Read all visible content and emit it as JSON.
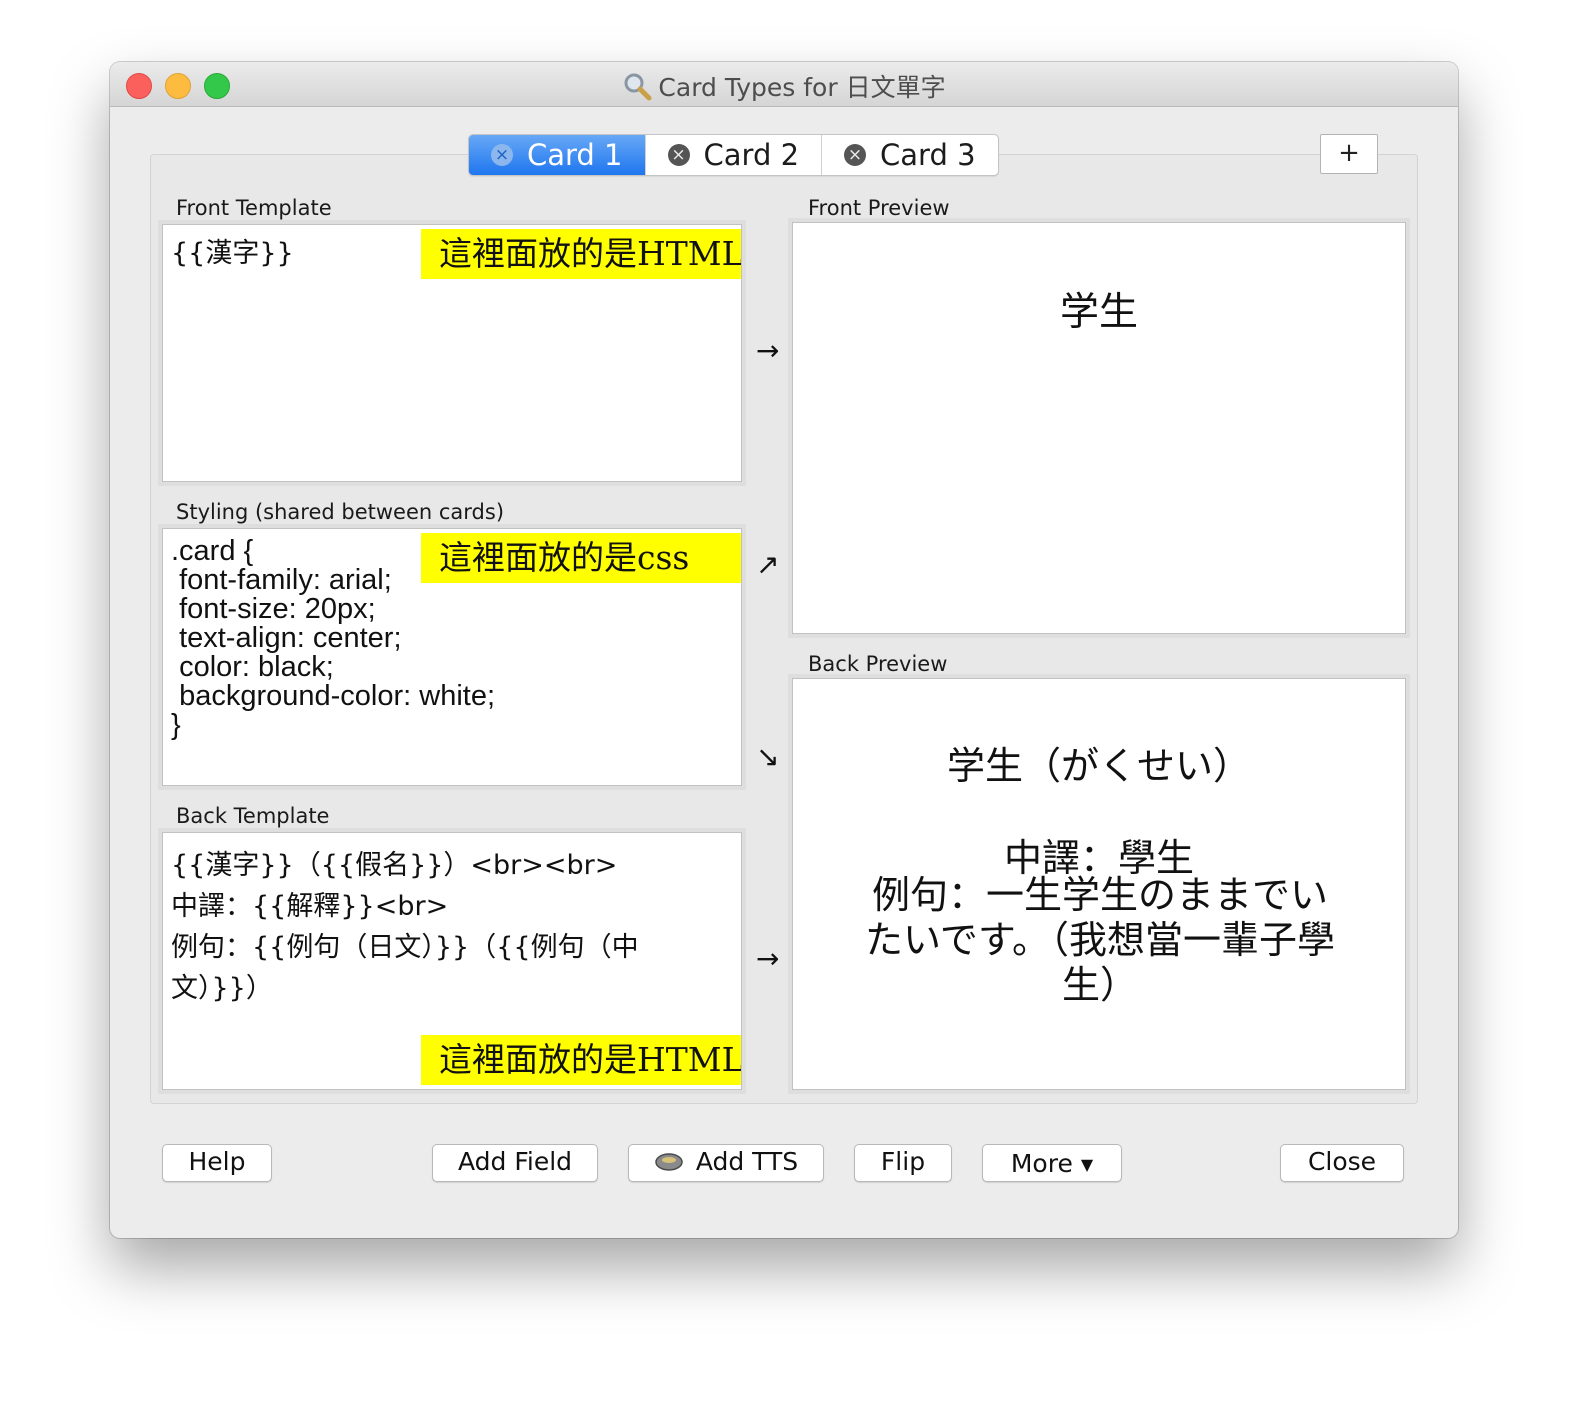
{
  "window": {
    "title": "Card Types for 日文單字",
    "title_icon": "magnifier-icon"
  },
  "tabs": [
    {
      "label": "Card 1",
      "active": true
    },
    {
      "label": "Card 2",
      "active": false
    },
    {
      "label": "Card 3",
      "active": false
    }
  ],
  "add_tab_label": "+",
  "front_template": {
    "label": "Front Template",
    "content": "{{漢字}}",
    "note": "這裡面放的是HTML"
  },
  "styling": {
    "label": "Styling (shared between cards)",
    "content": ".card {\n font-family: arial;\n font-size: 20px;\n text-align: center;\n color: black;\n background-color: white;\n}",
    "note": "這裡面放的是css"
  },
  "back_template": {
    "label": "Back Template",
    "content": "{{漢字}}（{{假名}}）<br><br>\n中譯：{{解釋}}<br>\n例句：{{例句（日文）}}（{{例句（中文）}}）",
    "note": "這裡面放的是HTML"
  },
  "front_preview": {
    "label": "Front Preview",
    "text": "学生"
  },
  "back_preview": {
    "label": "Back Preview",
    "line1": "学生（がくせい）",
    "line2": "中譯：學生",
    "line3": "例句：一生学生のままでいたいです。（我想當一輩子學生）"
  },
  "arrows": {
    "front": "→",
    "style_up": "↗",
    "style_down": "↘",
    "back": "→"
  },
  "buttons": {
    "help": "Help",
    "add_field": "Add Field",
    "add_tts": "Add TTS",
    "flip": "Flip",
    "more": "More",
    "close": "Close"
  },
  "colors": {
    "active_tab": "#1f76ef",
    "highlight": "#ffff00",
    "close_red": "#fc605c",
    "minimize_yellow": "#fdbc40",
    "zoom_green": "#34c84a"
  }
}
